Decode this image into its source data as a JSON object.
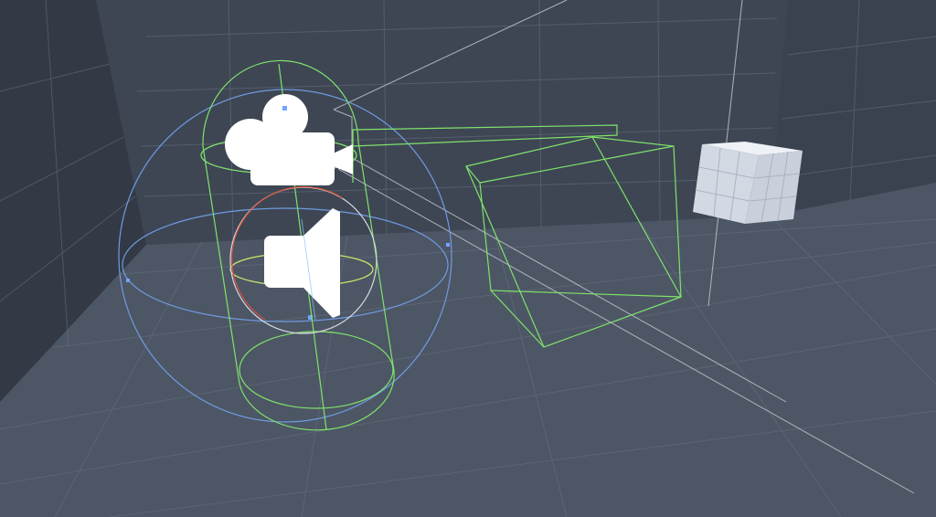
{
  "viewport": {
    "colors": {
      "back_wall": "#3e4654",
      "left_wall": "#343b47",
      "right_wall": "#3a4250",
      "floor": "#4e5766",
      "grid": "#66707e",
      "collision_green": "#7fe36a",
      "sphere_blue": "#6f9be0",
      "cube": "#d7dde8",
      "icon": "#ffffff"
    },
    "icons": [
      "camera-icon",
      "audio-speaker-icon"
    ]
  }
}
